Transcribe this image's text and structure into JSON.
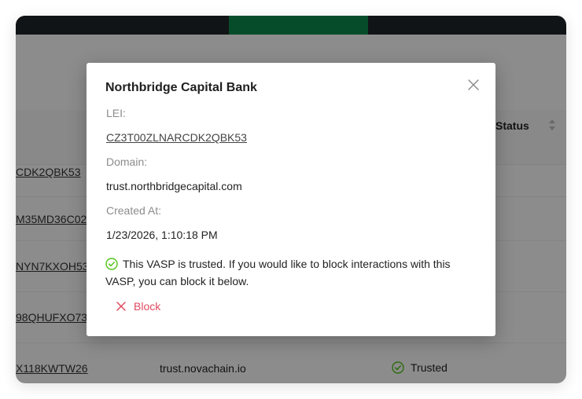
{
  "table": {
    "status_header": "Status",
    "rows": [
      {
        "lei": "CZ3T00ZLNARCDK2QBK53",
        "lei_visible": "CDK2QBK53",
        "domain": "",
        "status": ""
      },
      {
        "lei_visible": "M35MD36C02",
        "domain": "",
        "status": ""
      },
      {
        "lei_visible": "NYN7KXOH53",
        "domain": "",
        "status": ""
      },
      {
        "lei_visible": "98QHUFXO73",
        "domain": "",
        "status": ""
      },
      {
        "lei_visible": "X118KWTW26",
        "domain": "trust.novachain.io",
        "status": "Trusted"
      }
    ]
  },
  "modal": {
    "title": "Northbridge Capital Bank",
    "lei_label": "LEI",
    "lei_value": "CZ3T00ZLNARCDK2QBK53",
    "domain_label": "Domain",
    "domain_value": "trust.northbridgecapital.com",
    "created_label": "Created At",
    "created_value": "1/23/2026, 1:10:18 PM",
    "notice": "This VASP is trusted. If you would like to block interactions with this VASP, you can block it below.",
    "block_label": "Block",
    "colon": ":"
  },
  "colors": {
    "topbar": "#1f2528",
    "active_tab": "#0d8a4d",
    "trusted_icon": "#52c41a",
    "danger": "#e04a5f"
  }
}
